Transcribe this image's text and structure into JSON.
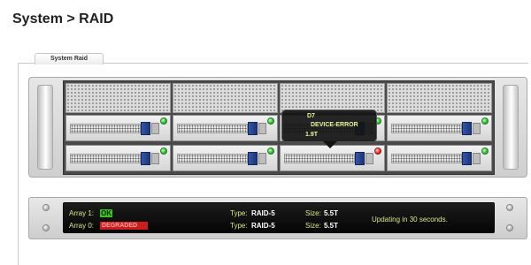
{
  "page": {
    "title": "System > RAID"
  },
  "tabs": [
    {
      "label": "System Raid",
      "active": true
    }
  ],
  "drives": [
    {
      "row": 1,
      "bay": 1,
      "status": "ok"
    },
    {
      "row": 1,
      "bay": 2,
      "status": "ok"
    },
    {
      "row": 1,
      "bay": 3,
      "status": "ok"
    },
    {
      "row": 1,
      "bay": 4,
      "status": "ok"
    },
    {
      "row": 2,
      "bay": 1,
      "status": "ok"
    },
    {
      "row": 2,
      "bay": 2,
      "status": "ok"
    },
    {
      "row": 2,
      "bay": 3,
      "status": "error"
    },
    {
      "row": 2,
      "bay": 4,
      "status": "ok"
    }
  ],
  "tooltip": {
    "line1": "D7",
    "line2": "DEVICE-ERROR",
    "line3": "1.9T"
  },
  "arrays": [
    {
      "label": "Array 1:",
      "status": "OK",
      "type_label": "Type:",
      "type": "RAID-5",
      "size_label": "Size:",
      "size": "5.5T"
    },
    {
      "label": "Array 0:",
      "status": "DEGRADED",
      "type_label": "Type:",
      "type": "RAID-5",
      "size_label": "Size:",
      "size": "5.5T"
    }
  ],
  "update_message": "Updating in 30 seconds.",
  "colors": {
    "ok_led": "#2ec02e",
    "error_led": "#e53030",
    "status_text": "#d7e98a",
    "drive_latch": "#2a4a9a"
  }
}
